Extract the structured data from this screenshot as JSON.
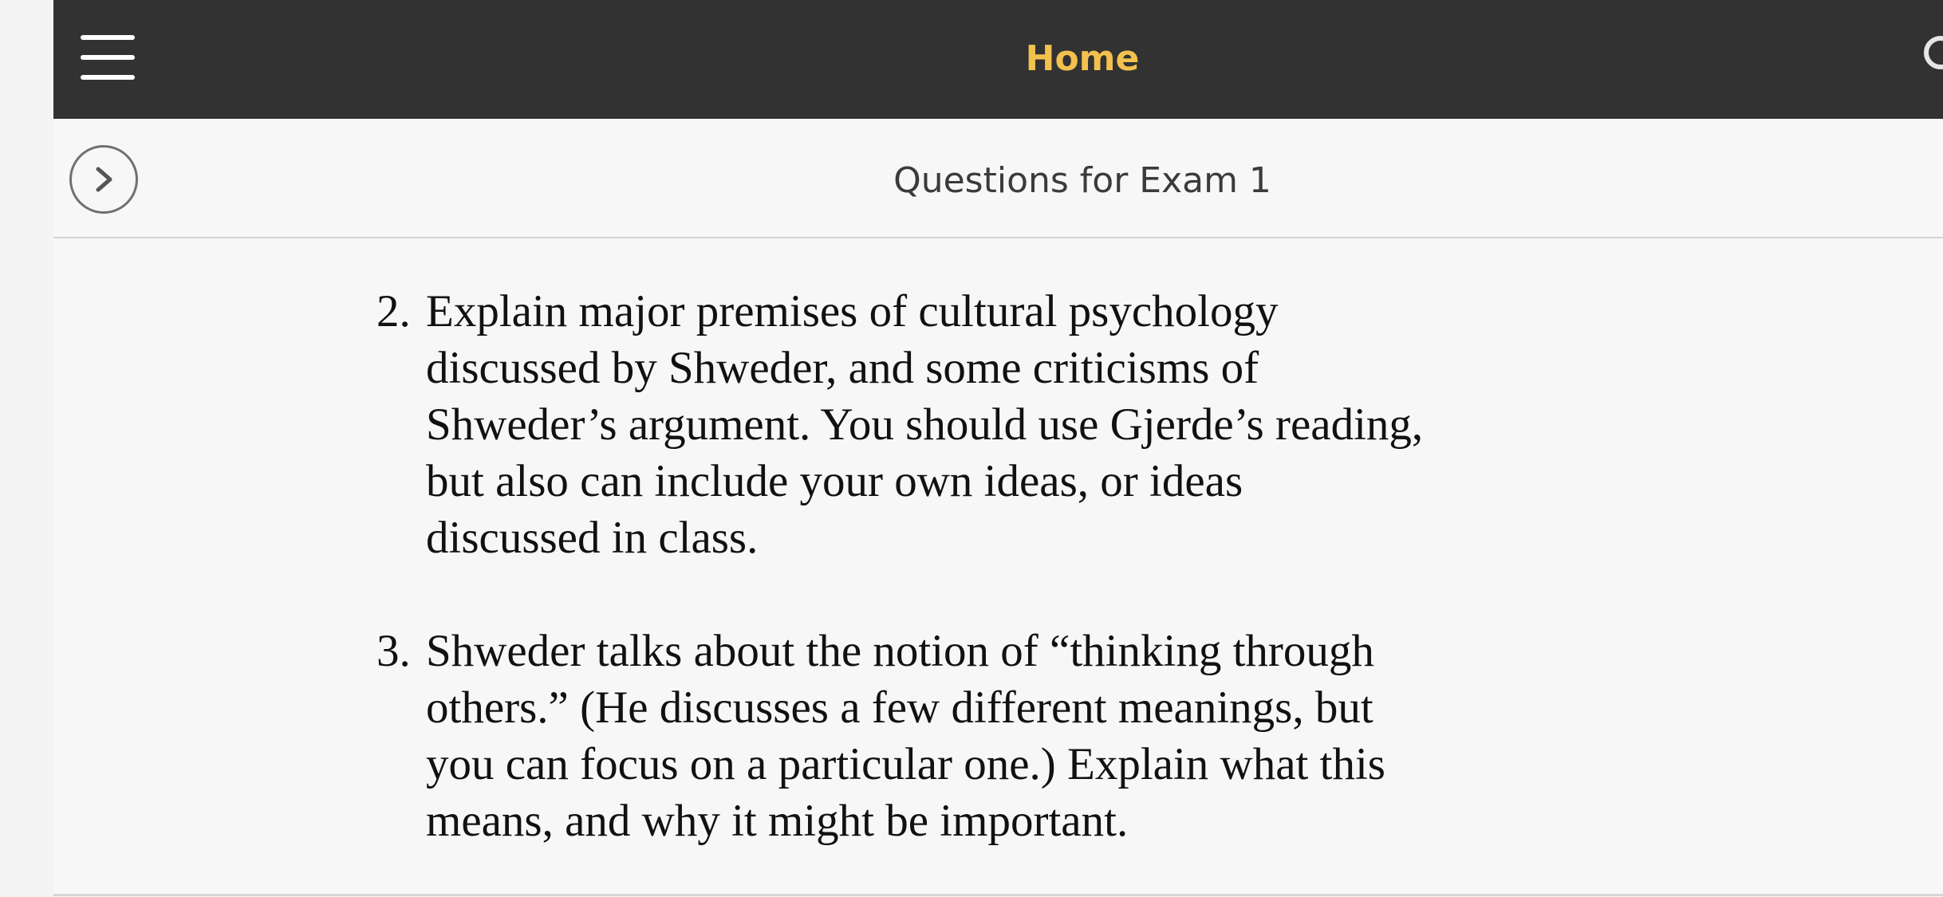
{
  "topbar": {
    "title": "Home",
    "title_color": "#f2c14e",
    "background": "#323232",
    "menu_icon": "hamburger-menu-icon",
    "search_icon": "search-icon"
  },
  "subheader": {
    "nav_icon": "chevron-right-icon",
    "title": "Questions for Exam 1"
  },
  "content": {
    "questions": [
      {
        "number": "2.",
        "lines": [
          "Explain major premises of cultural psychology",
          "discussed by Shweder, and some criticisms of",
          "Shweder’s argument. You should use Gjerde’s reading,",
          "but also can include your own ideas, or ideas",
          "discussed in class."
        ]
      },
      {
        "number": "3.",
        "lines": [
          "Shweder talks about the notion of “thinking through",
          "others.” (He discusses a few different meanings, but",
          "you can focus on a particular one.) Explain what this",
          "means, and why it might be important."
        ]
      }
    ]
  }
}
